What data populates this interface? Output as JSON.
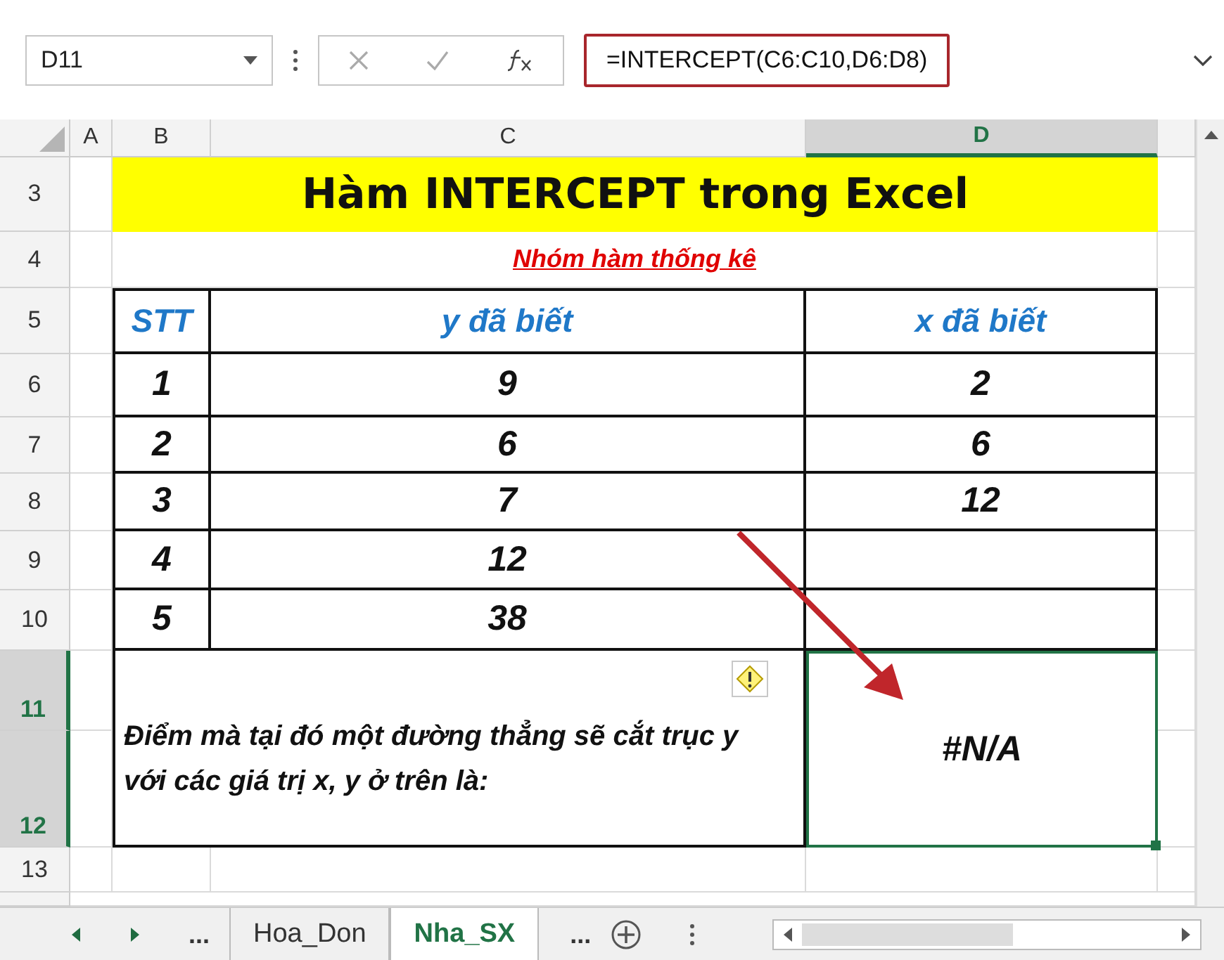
{
  "formula_bar": {
    "name_box": "D11",
    "formula": "=INTERCEPT(C6:C10,D6:D8)"
  },
  "columns": [
    {
      "label": "A",
      "selected": false
    },
    {
      "label": "B",
      "selected": false
    },
    {
      "label": "C",
      "selected": false
    },
    {
      "label": "D",
      "selected": true
    }
  ],
  "rows": [
    {
      "label": "3",
      "selected": false
    },
    {
      "label": "4",
      "selected": false
    },
    {
      "label": "5",
      "selected": false
    },
    {
      "label": "6",
      "selected": false
    },
    {
      "label": "7",
      "selected": false
    },
    {
      "label": "8",
      "selected": false
    },
    {
      "label": "9",
      "selected": false
    },
    {
      "label": "10",
      "selected": false
    },
    {
      "label": "11",
      "selected": true
    },
    {
      "label": "12",
      "selected": true
    },
    {
      "label": "13",
      "selected": false
    }
  ],
  "title": "Hàm INTERCEPT trong Excel",
  "subtitle": "Nhóm hàm thống kê",
  "table": {
    "columns": [
      "STT",
      "y đã biết",
      "x đã biết"
    ],
    "rows": [
      [
        "1",
        "9",
        "2"
      ],
      [
        "2",
        "6",
        "6"
      ],
      [
        "3",
        "7",
        "12"
      ],
      [
        "4",
        "12",
        ""
      ],
      [
        "5",
        "38",
        ""
      ]
    ]
  },
  "result": {
    "label": "Điểm mà tại đó một đường thẳng sẽ cắt trục y với các giá trị x, y ở trên là:",
    "value": "#N/A"
  },
  "sheet_tabs": {
    "overflow_left": "...",
    "tabs": [
      {
        "label": "Hoa_Don",
        "selected": false
      },
      {
        "label": "Nha_SX",
        "selected": true
      }
    ],
    "overflow_right": "..."
  }
}
